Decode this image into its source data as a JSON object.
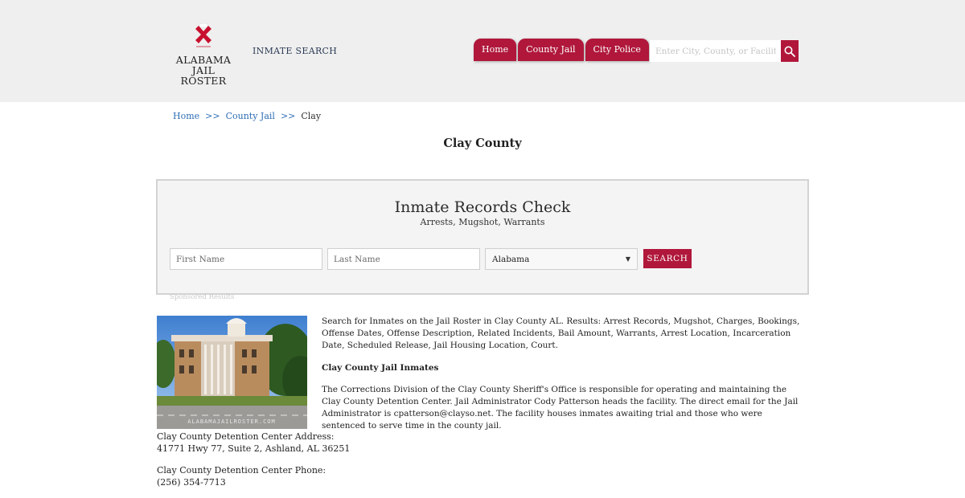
{
  "header": {
    "logo_line1": "ALABAMA",
    "logo_line2": "JAIL ROSTER",
    "inmate_search": "INMATE SEARCH",
    "nav": [
      "Home",
      "County Jail",
      "City Police"
    ],
    "search_placeholder": "Enter City, County, or Facility"
  },
  "breadcrumb": {
    "home": "Home",
    "sep": ">>",
    "county_jail": "County Jail",
    "current": "Clay"
  },
  "page_title": "Clay County",
  "records_check": {
    "title": "Inmate Records Check",
    "subtitle": "Arrests, Mugshot, Warrants",
    "first_name_placeholder": "First Name",
    "last_name_placeholder": "Last Name",
    "state_selected": "Alabama",
    "search_button": "SEARCH"
  },
  "sponsored": "Sponsored Results",
  "photo": {
    "watermark": "ALABAMAJAILROSTER.COM"
  },
  "sidebar": {
    "address_label": "Clay County Detention Center Address:",
    "address_value": "41771 Hwy 77, Suite 2, Ashland, AL 36251",
    "phone_label": "Clay County Detention Center Phone:",
    "phone_value": "(256) 354-7713"
  },
  "content": {
    "intro": "Search for Inmates on the Jail Roster in Clay County AL. Results: Arrest Records, Mugshot, Charges, Bookings, Offense Dates, Offense Description, Related Incidents, Bail Amount, Warrants, Arrest Location, Incarceration Date, Scheduled Release, Jail Housing Location, Court.",
    "heading": "Clay County Jail Inmates",
    "body": "The Corrections Division of the Clay County Sheriff's Office is responsible for operating and maintaining the Clay County Detention Center. Jail Administrator Cody Patterson heads the facility. The direct email for the Jail Administrator is cpatterson@clayso.net. The facility houses inmates awaiting trial and those who were sentenced to serve time in the county jail."
  },
  "colors": {
    "accent": "#b0173b",
    "header_bg": "#efefef",
    "link": "#2d6db5"
  }
}
